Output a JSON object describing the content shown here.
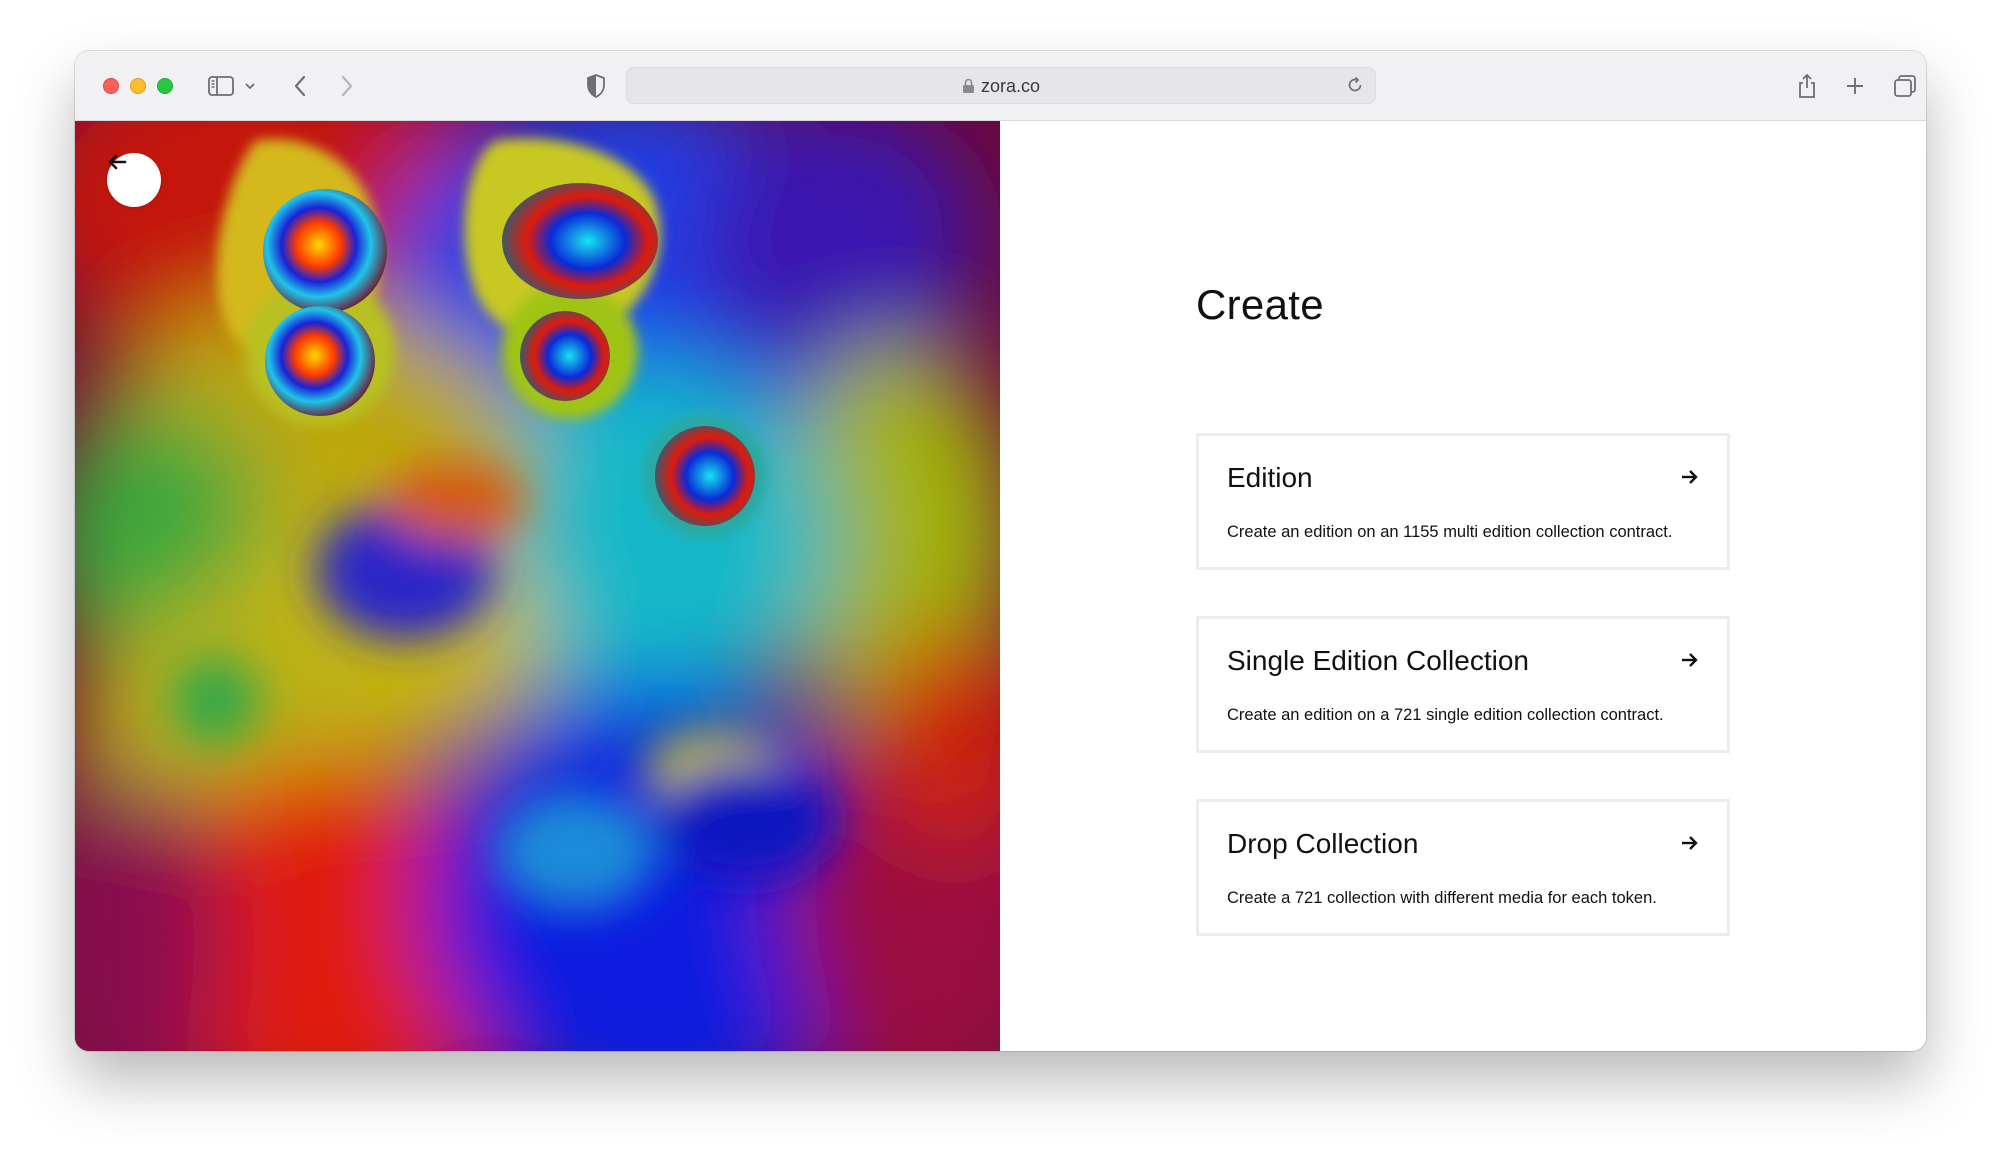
{
  "browser": {
    "url": "zora.co",
    "icons": {
      "sidebar": "sidebar-icon",
      "chevron": "chevron-down-icon",
      "back": "chevron-left-icon",
      "forward": "chevron-right-icon",
      "privacy": "shield-icon",
      "lock": "lock-icon",
      "reload": "reload-icon",
      "share": "share-icon",
      "new_tab": "plus-icon",
      "tabs": "tabs-overview-icon"
    }
  },
  "page": {
    "back_icon": "arrow-left-icon",
    "title": "Create",
    "options": [
      {
        "title": "Edition",
        "description": "Create an edition on an 1155 multi edition collection contract.",
        "icon": "arrow-right-icon"
      },
      {
        "title": "Single Edition Collection",
        "description": "Create an edition on a 721 single edition collection contract.",
        "icon": "arrow-right-icon"
      },
      {
        "title": "Drop Collection",
        "description": "Create a 721 collection with different media for each token.",
        "icon": "arrow-right-icon"
      }
    ]
  },
  "colors": {
    "red": "#e01a0a",
    "blue": "#0a1de0",
    "yellow": "#d8c20c",
    "green": "#2fae3a",
    "cyan": "#1cc3d8",
    "crimson": "#7a0a22"
  }
}
